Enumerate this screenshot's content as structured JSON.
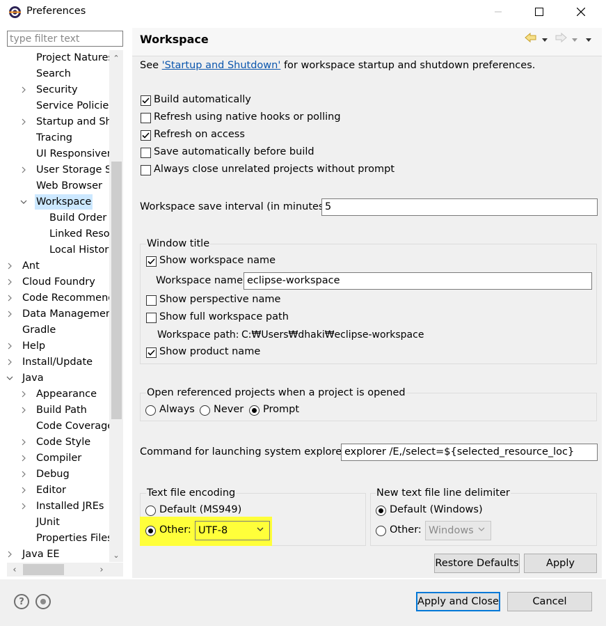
{
  "window": {
    "title": "Preferences"
  },
  "filter": {
    "placeholder": "type filter text"
  },
  "tree": [
    {
      "label": "Project Natures",
      "indent": 2,
      "arrow": ""
    },
    {
      "label": "Search",
      "indent": 2,
      "arrow": ""
    },
    {
      "label": "Security",
      "indent": 2,
      "arrow": "right"
    },
    {
      "label": "Service Policies",
      "indent": 2,
      "arrow": ""
    },
    {
      "label": "Startup and Sh",
      "indent": 2,
      "arrow": "right"
    },
    {
      "label": "Tracing",
      "indent": 2,
      "arrow": ""
    },
    {
      "label": "UI Responsiven",
      "indent": 2,
      "arrow": ""
    },
    {
      "label": "User Storage Se",
      "indent": 2,
      "arrow": "right"
    },
    {
      "label": "Web Browser",
      "indent": 2,
      "arrow": ""
    },
    {
      "label": "Workspace",
      "indent": 2,
      "arrow": "down",
      "selected": true
    },
    {
      "label": "Build Order",
      "indent": 3,
      "arrow": ""
    },
    {
      "label": "Linked Reso",
      "indent": 3,
      "arrow": ""
    },
    {
      "label": "Local History",
      "indent": 3,
      "arrow": ""
    },
    {
      "label": "Ant",
      "indent": 1,
      "arrow": "right"
    },
    {
      "label": "Cloud Foundry",
      "indent": 1,
      "arrow": "right"
    },
    {
      "label": "Code Recommend",
      "indent": 1,
      "arrow": "right"
    },
    {
      "label": "Data Managemen",
      "indent": 1,
      "arrow": "right"
    },
    {
      "label": "Gradle",
      "indent": 1,
      "arrow": ""
    },
    {
      "label": "Help",
      "indent": 1,
      "arrow": "right"
    },
    {
      "label": "Install/Update",
      "indent": 1,
      "arrow": "right"
    },
    {
      "label": "Java",
      "indent": 1,
      "arrow": "down"
    },
    {
      "label": "Appearance",
      "indent": 2,
      "arrow": "right"
    },
    {
      "label": "Build Path",
      "indent": 2,
      "arrow": "right"
    },
    {
      "label": "Code Coverage",
      "indent": 2,
      "arrow": ""
    },
    {
      "label": "Code Style",
      "indent": 2,
      "arrow": "right"
    },
    {
      "label": "Compiler",
      "indent": 2,
      "arrow": "right"
    },
    {
      "label": "Debug",
      "indent": 2,
      "arrow": "right"
    },
    {
      "label": "Editor",
      "indent": 2,
      "arrow": "right"
    },
    {
      "label": "Installed JREs",
      "indent": 2,
      "arrow": "right"
    },
    {
      "label": "JUnit",
      "indent": 2,
      "arrow": ""
    },
    {
      "label": "Properties Files",
      "indent": 2,
      "arrow": ""
    },
    {
      "label": "Java EE",
      "indent": 1,
      "arrow": "right"
    }
  ],
  "page": {
    "title": "Workspace",
    "see_prefix": "See ",
    "see_link": "'Startup and Shutdown'",
    "see_suffix": " for workspace startup and shutdown preferences."
  },
  "checkboxes": {
    "build_automatically": {
      "label": "Build automatically",
      "checked": true
    },
    "refresh_native": {
      "label": "Refresh using native hooks or polling",
      "checked": false
    },
    "refresh_access": {
      "label": "Refresh on access",
      "checked": true
    },
    "save_before_build": {
      "label": "Save automatically before build",
      "checked": false
    },
    "close_unrelated": {
      "label": "Always close unrelated projects without prompt",
      "checked": false
    }
  },
  "save_interval": {
    "label": "Workspace save interval (in minutes):",
    "value": "5"
  },
  "window_title": {
    "group_label": "Window title",
    "show_workspace_name": {
      "label": "Show workspace name",
      "checked": true
    },
    "workspace_name_label": "Workspace name:",
    "workspace_name_value": "eclipse-workspace",
    "show_perspective_name": {
      "label": "Show perspective name",
      "checked": false
    },
    "show_full_path": {
      "label": "Show full workspace path",
      "checked": false
    },
    "workspace_path_label": "Workspace path:",
    "workspace_path_value": "C:₩Users₩dhaki₩eclipse-workspace",
    "show_product_name": {
      "label": "Show product name",
      "checked": true
    }
  },
  "open_referenced": {
    "group_label": "Open referenced projects when a project is opened",
    "options": [
      "Always",
      "Never",
      "Prompt"
    ],
    "selected": "Prompt"
  },
  "system_explorer": {
    "label": "Command for launching system explorer:",
    "value": "explorer /E,/select=${selected_resource_loc}"
  },
  "encoding": {
    "group_label": "Text file encoding",
    "default_label": "Default (MS949)",
    "other_label": "Other:",
    "selected": "Other",
    "other_value": "UTF-8"
  },
  "line_delimiter": {
    "group_label": "New text file line delimiter",
    "default_label": "Default (Windows)",
    "other_label": "Other:",
    "selected": "Default",
    "other_value": "Windows"
  },
  "buttons": {
    "restore_defaults": "Restore Defaults",
    "apply": "Apply",
    "apply_close": "Apply and Close",
    "cancel": "Cancel"
  },
  "colors": {
    "highlight": "#ffff3a",
    "selection": "#cce8ff",
    "link": "#0b56ad",
    "default_button_border": "#0078d7"
  }
}
